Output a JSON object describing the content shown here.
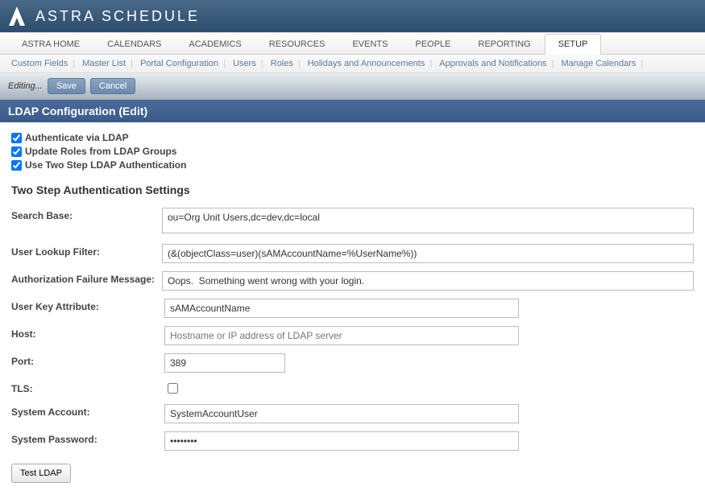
{
  "app": {
    "title": "ASTRA SCHEDULE"
  },
  "mainNav": {
    "items": [
      {
        "label": "ASTRA HOME",
        "active": false
      },
      {
        "label": "CALENDARS",
        "active": false
      },
      {
        "label": "ACADEMICS",
        "active": false
      },
      {
        "label": "RESOURCES",
        "active": false
      },
      {
        "label": "EVENTS",
        "active": false
      },
      {
        "label": "PEOPLE",
        "active": false
      },
      {
        "label": "REPORTING",
        "active": false
      },
      {
        "label": "SETUP",
        "active": true
      }
    ]
  },
  "subNav": {
    "items": [
      "Custom Fields",
      "Master List",
      "Portal Configuration",
      "Users",
      "Roles",
      "Holidays and Announcements",
      "Approvals and Notifications",
      "Manage Calendars"
    ]
  },
  "toolbar": {
    "status": "Editing...",
    "save": "Save",
    "cancel": "Cancel"
  },
  "pageTitle": "LDAP Configuration (Edit)",
  "checks": {
    "authViaLdap": {
      "label": "Authenticate via LDAP",
      "checked": true
    },
    "updateRoles": {
      "label": "Update Roles from LDAP Groups",
      "checked": true
    },
    "twoStep": {
      "label": "Use Two Step LDAP Authentication",
      "checked": true
    }
  },
  "sectionTitle": "Two Step Authentication Settings",
  "form": {
    "searchBase": {
      "label": "Search Base:",
      "value": "ou=Org Unit Users,dc=dev,dc=local"
    },
    "lookupFilter": {
      "label": "User Lookup Filter:",
      "value": "(&(objectClass=user)(sAMAccountName=%UserName%))"
    },
    "authFailMsg": {
      "label": "Authorization Failure Message:",
      "value": "Oops.  Something went wrong with your login."
    },
    "userKeyAttr": {
      "label": "User Key Attribute:",
      "value": "sAMAccountName"
    },
    "host": {
      "label": "Host:",
      "value": "",
      "placeholder": "Hostname or IP address of LDAP server"
    },
    "port": {
      "label": "Port:",
      "value": "389"
    },
    "tls": {
      "label": "TLS:",
      "checked": false
    },
    "sysAccount": {
      "label": "System Account:",
      "value": "SystemAccountUser"
    },
    "sysPassword": {
      "label": "System Password:",
      "value": "••••••••"
    }
  },
  "testButton": "Test LDAP"
}
